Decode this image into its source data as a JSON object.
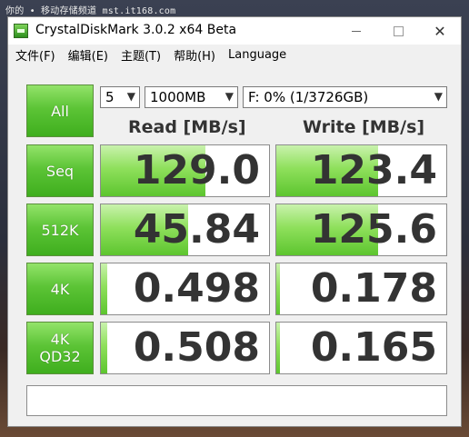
{
  "watermark": "你的 • 移动存储频道 mst.it168.com",
  "window": {
    "title": "CrystalDiskMark 3.0.2 x64 Beta",
    "min_label": "",
    "max_label": "",
    "close_label": "✕"
  },
  "menu": [
    "文件(F)",
    "编辑(E)",
    "主题(T)",
    "帮助(H)",
    "Language"
  ],
  "controls": {
    "all_label": "All",
    "count": "5",
    "size": "1000MB",
    "drive": "F: 0% (1/3726GB)"
  },
  "headers": {
    "read": "Read [MB/s]",
    "write": "Write [MB/s]"
  },
  "rows": [
    {
      "label_line1": "Seq",
      "label_line2": "",
      "read": "129.0",
      "write": "123.4",
      "read_fill": 0.62,
      "write_fill": 0.6
    },
    {
      "label_line1": "512K",
      "label_line2": "",
      "read": "45.84",
      "write": "125.6",
      "read_fill": 0.52,
      "write_fill": 0.6
    },
    {
      "label_line1": "4K",
      "label_line2": "",
      "read": "0.498",
      "write": "0.178",
      "read_fill": 0.04,
      "write_fill": 0.02
    },
    {
      "label_line1": "4K",
      "label_line2": "QD32",
      "read": "0.508",
      "write": "0.165",
      "read_fill": 0.04,
      "write_fill": 0.02
    }
  ],
  "comment": "",
  "colors": {
    "accent_green": "#5cc436",
    "bar_green": "#8fe05c",
    "text_dark": "#333333"
  }
}
